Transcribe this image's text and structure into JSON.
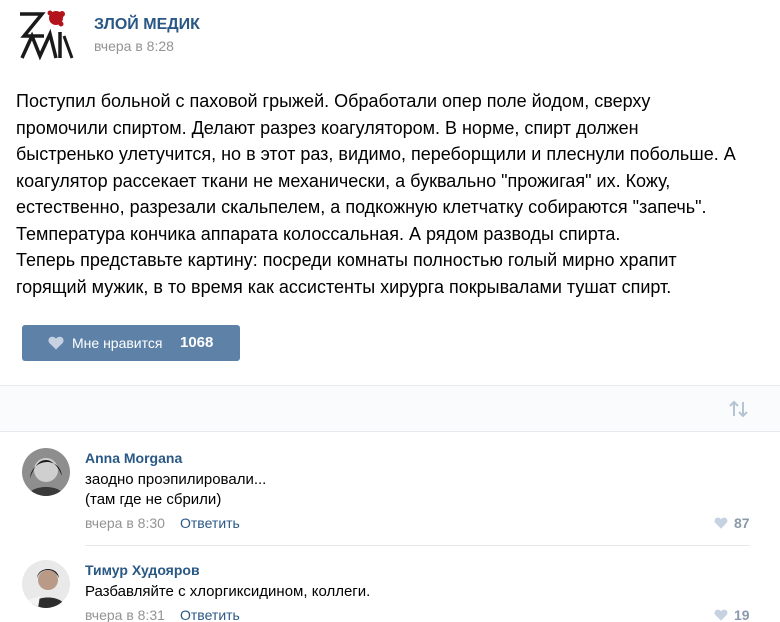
{
  "post": {
    "author": "ЗЛОЙ МЕДИК",
    "time": "вчера в 8:28",
    "text_lines": [
      "Поступил больной с паховой грыжей. Обработали опер поле йодом, сверху",
      "промочили спиртом. Делают разрез коагулятором. В норме, спирт должен",
      "быстренько улетучится, но в этот раз, видимо, переборщили и плеснули побольше. А",
      "коагулятор рассекает ткани не механически, а буквально \"прожигая\" их. Кожу,",
      "естественно, разрезали скальпелем, а подкожную клетчатку собираются \"запечь\".",
      "Температура кончика аппарата колоссальная. А рядом разводы спирта.",
      "Теперь представьте картину: посреди комнаты полностью голый мирно храпит",
      "горящий мужик, в то время как ассистенты хирурга покрывалами тушат спирт."
    ],
    "like_label": "Мне нравится",
    "like_count": "1068"
  },
  "comments": [
    {
      "author": "Anna Morgana",
      "text_lines": [
        "заодно проэпилировали...",
        "(там где не сбрили)"
      ],
      "time": "вчера в 8:30",
      "reply": "Ответить",
      "likes": "87"
    },
    {
      "author": "Тимур Худояров",
      "text_lines": [
        "Разбавляйте с хлоргиксидином, коллеги."
      ],
      "time": "вчера в 8:31",
      "reply": "Ответить",
      "likes": "19"
    }
  ],
  "colors": {
    "link": "#2a5885",
    "button": "#5e81a8",
    "muted": "#939393",
    "like_muted": "#8a99ab",
    "logo_red": "#b3141b"
  },
  "icons": {
    "logo": "zm-logo-icon",
    "like": "heart-icon",
    "sort": "sort-arrows-icon"
  }
}
